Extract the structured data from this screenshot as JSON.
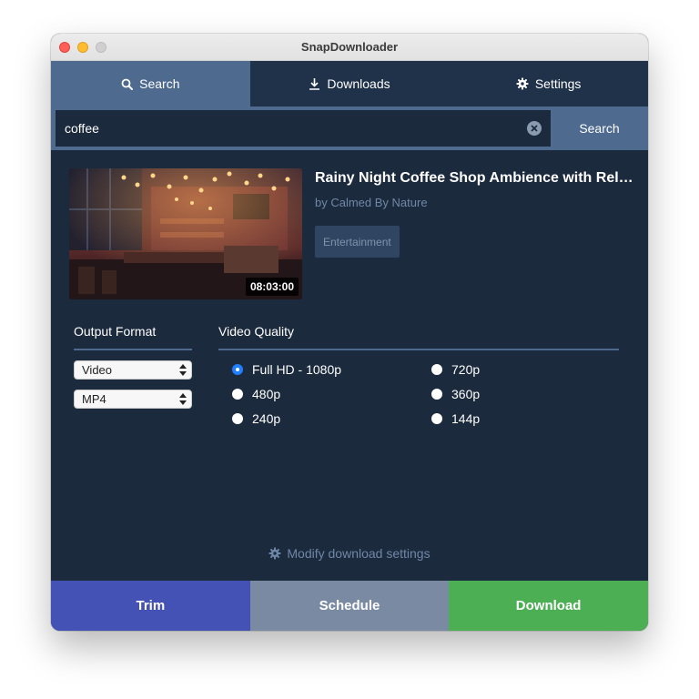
{
  "window": {
    "title": "SnapDownloader"
  },
  "tabs": [
    {
      "label": "Search",
      "icon": "search-icon"
    },
    {
      "label": "Downloads",
      "icon": "download-icon"
    },
    {
      "label": "Settings",
      "icon": "gear-icon"
    }
  ],
  "search": {
    "value": "coffee",
    "button_label": "Search"
  },
  "video": {
    "title": "Rainy Night Coffee Shop Ambience with Rela...",
    "channel": "by Calmed By Nature",
    "category": "Entertainment",
    "duration": "08:03:00"
  },
  "output_format": {
    "label": "Output Format",
    "type_selected": "Video",
    "container_selected": "MP4"
  },
  "video_quality": {
    "label": "Video Quality",
    "options": [
      "Full HD - 1080p",
      "720p",
      "480p",
      "360p",
      "240p",
      "144p"
    ],
    "selected": "Full HD - 1080p"
  },
  "modify_link": "Modify download settings",
  "actions": {
    "trim": "Trim",
    "schedule": "Schedule",
    "download": "Download"
  },
  "colors": {
    "background": "#1c2a3d",
    "tab_active": "#4e6b8f",
    "trim": "#4352b4",
    "schedule": "#7a8aa3",
    "download": "#4caf54",
    "muted_text": "#6f87a6",
    "radio_checked": "#1f7fff"
  }
}
